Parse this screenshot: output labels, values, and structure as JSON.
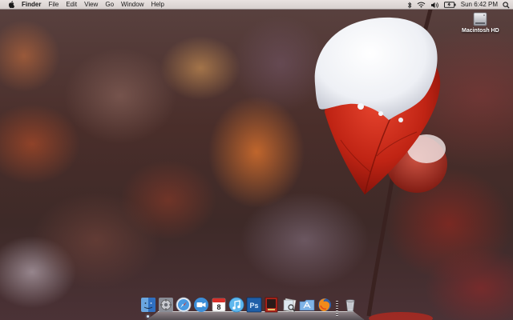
{
  "menubar": {
    "apple_icon": "apple-icon",
    "app_name": "Finder",
    "items": [
      "File",
      "Edit",
      "View",
      "Go",
      "Window",
      "Help"
    ],
    "status_icons": [
      "bluetooth-icon",
      "wifi-icon",
      "volume-icon",
      "battery-icon"
    ],
    "clock": "Sun 6:42 PM",
    "spotlight_icon": "spotlight-search-icon"
  },
  "desktop": {
    "drive_label": "Macintosh HD",
    "drive_icon": "hard-drive-icon"
  },
  "dock": {
    "apps": [
      {
        "name": "finder",
        "icon": "finder-icon",
        "running": true
      },
      {
        "name": "system-preferences",
        "icon": "system-preferences-icon",
        "running": false
      },
      {
        "name": "safari",
        "icon": "safari-icon",
        "running": false
      },
      {
        "name": "facetime",
        "icon": "facetime-icon",
        "running": false
      },
      {
        "name": "ical",
        "icon": "calendar-icon",
        "running": false,
        "badge": "8"
      },
      {
        "name": "itunes",
        "icon": "itunes-icon",
        "running": false
      },
      {
        "name": "photoshop",
        "icon": "photoshop-icon",
        "running": false,
        "badge": "Ps"
      },
      {
        "name": "photo-booth",
        "icon": "photo-booth-icon",
        "running": false
      },
      {
        "name": "preview",
        "icon": "preview-icon",
        "running": false
      },
      {
        "name": "applications-folder",
        "icon": "applications-folder-icon",
        "running": false
      },
      {
        "name": "firefox",
        "icon": "firefox-icon",
        "running": false
      }
    ],
    "trash_icon": "trash-icon"
  },
  "colors": {
    "menubar_bg": "#efebe9",
    "leaf_red": "#c72a1c",
    "snow": "#f6f7fa",
    "photoshop_blue": "#1f5fa8"
  }
}
